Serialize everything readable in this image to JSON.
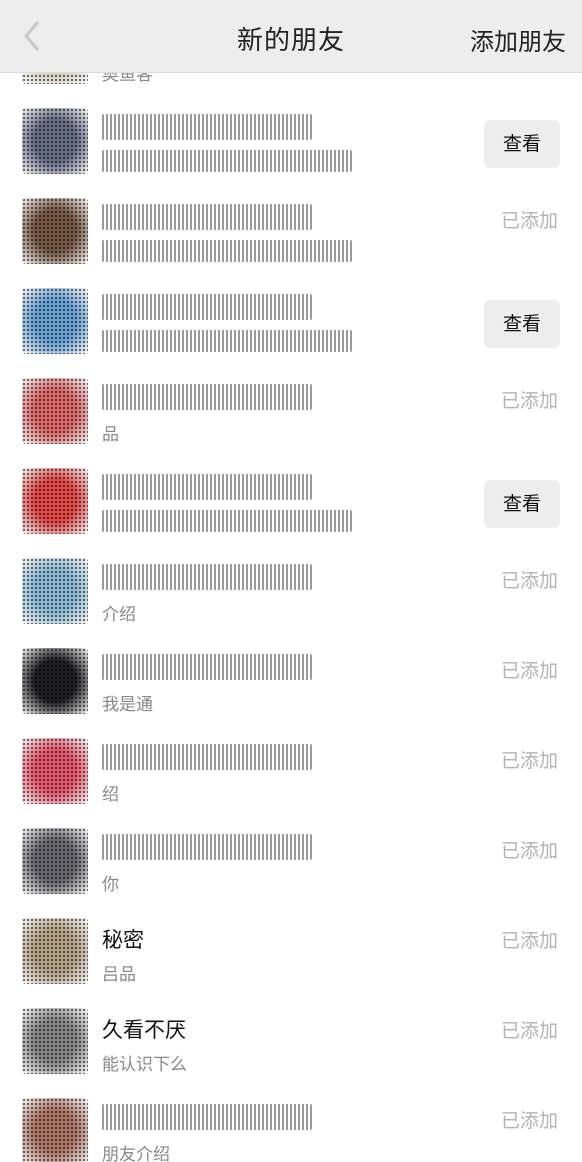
{
  "header": {
    "title": "新的朋友",
    "add_label": "添加朋友"
  },
  "rows": [
    {
      "name": "",
      "desc": "奥鱼客",
      "name_blur": false,
      "desc_blur": false,
      "status": "",
      "button": "",
      "avatar_color": "#d9d3c2"
    },
    {
      "name": "blurred",
      "desc": "blurred",
      "name_blur": true,
      "desc_blur": true,
      "status": "",
      "button": "查看",
      "avatar_color": "#6a6f8a"
    },
    {
      "name": "blurred",
      "desc": "blurred",
      "name_blur": true,
      "desc_blur": true,
      "status": "已添加",
      "button": "",
      "avatar_color": "#7a5a48"
    },
    {
      "name": "blurred",
      "desc": "blurred",
      "name_blur": true,
      "desc_blur": true,
      "status": "",
      "button": "查看",
      "avatar_color": "#6aa4d8"
    },
    {
      "name": "blurred",
      "desc": "品",
      "name_blur": true,
      "desc_blur": false,
      "status": "已添加",
      "button": "",
      "avatar_color": "#e06b6b"
    },
    {
      "name": "blurred",
      "desc": "blurred",
      "name_blur": true,
      "desc_blur": true,
      "status": "",
      "button": "查看",
      "avatar_color": "#e74a4a"
    },
    {
      "name": "blurred",
      "desc": "介绍",
      "name_blur": true,
      "desc_blur": false,
      "status": "已添加",
      "button": "",
      "avatar_color": "#8fbfd8"
    },
    {
      "name": "blurred",
      "desc": "我是通",
      "name_blur": true,
      "desc_blur": false,
      "status": "已添加",
      "button": "",
      "avatar_color": "#202024"
    },
    {
      "name": "blurred",
      "desc": "绍",
      "name_blur": true,
      "desc_blur": false,
      "status": "已添加",
      "button": "",
      "avatar_color": "#ea5a6e"
    },
    {
      "name": "blurred",
      "desc": "你",
      "name_blur": true,
      "desc_blur": false,
      "status": "已添加",
      "button": "",
      "avatar_color": "#6d6a72"
    },
    {
      "name": "秘密",
      "desc": "吕品",
      "name_blur": false,
      "desc_blur": false,
      "status": "已添加",
      "button": "",
      "avatar_color": "#b9a58a"
    },
    {
      "name": "久看不厌",
      "desc": "能认识下么",
      "name_blur": false,
      "desc_blur": false,
      "status": "已添加",
      "button": "",
      "avatar_color": "#8a8a8a"
    },
    {
      "name": "blurred",
      "desc": "朋友介绍",
      "name_blur": true,
      "desc_blur": false,
      "status": "已添加",
      "button": "",
      "avatar_color": "#b07a6a"
    }
  ]
}
